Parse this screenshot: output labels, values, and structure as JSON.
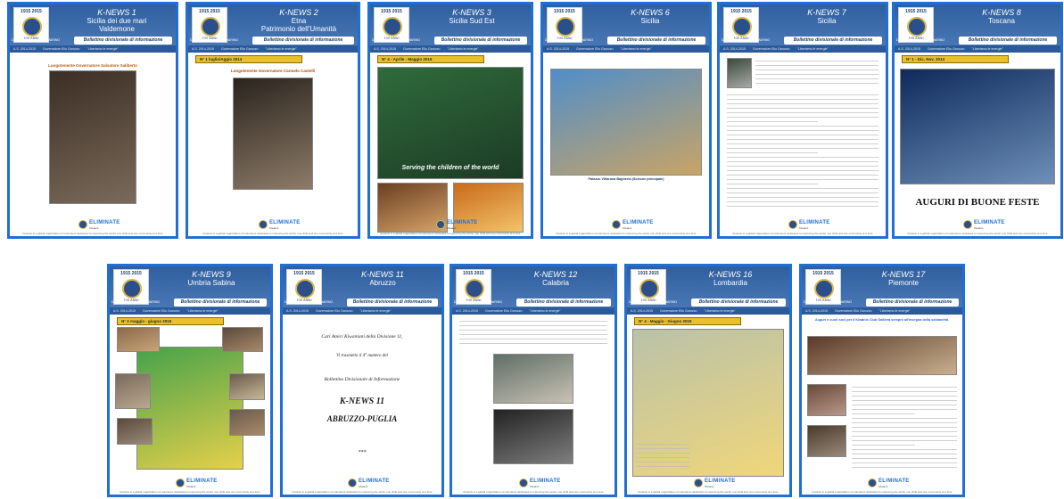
{
  "header": {
    "anniversary_years": "1915 2015",
    "anniversary_label": "100 ANNI",
    "district_line": "DISTRETTO ITALIA SAN MARINO",
    "subtitle": "Bollettino divisionale di informazione",
    "year_line": "A.S. 2014-2015",
    "governor_line": "Governatore Elio Garozzo",
    "motto": "\"Liberiamo le energie\""
  },
  "footer": {
    "brand": "ELIMINATE",
    "brand_sub": "Kiwanis",
    "tagline": "Kiwanis is a global organization of volunteers dedicated to improving the world, one child and one community at a time"
  },
  "issues": [
    {
      "title": "K-NEWS 1",
      "region_line1": "Sicilia dei due mari",
      "region_line2": "Valdemone",
      "gold_bar": "",
      "caption": "Luogotenente Governatore Salvatore Saliberto",
      "photo_colors": [
        "#3b2e24",
        "#7a6a5a"
      ]
    },
    {
      "title": "K-NEWS 2",
      "region_line1": "Etna",
      "region_line2": "Patrimonio dell'Umanità",
      "gold_bar": "N° 1 luglio/Aggio 2014",
      "caption": "Luogotenente Governatore Carmelo Castelli",
      "photo_colors": [
        "#2a241e",
        "#8d7b68"
      ]
    },
    {
      "title": "K-NEWS 3",
      "region_line1": "Sicilia Sud Est",
      "region_line2": "",
      "gold_bar": "N° 4 - Aprile - Maggio 2015",
      "caption": "Serving the children of the world",
      "photo_colors": [
        "#2f6b3a",
        "#1c3b26"
      ]
    },
    {
      "title": "K-NEWS 6",
      "region_line1": "Sicilia",
      "region_line2": "",
      "gold_bar": "",
      "caption": "Palazzo Villarosa Bagheria  (Sezione principale)",
      "photo_colors": [
        "#c9a466",
        "#4f8ec9"
      ]
    },
    {
      "title": "K-NEWS 7",
      "region_line1": "Sicilia",
      "region_line2": "",
      "gold_bar": "",
      "caption": "",
      "photo_colors": [
        "#3a4a3a",
        "#a8a8a8"
      ]
    },
    {
      "title": "K-NEWS 8",
      "region_line1": "Toscana",
      "region_line2": "",
      "gold_bar": "N° 1 - Dic. Nov. 2014",
      "caption": "AUGURI DI BUONE FESTE",
      "photo_colors": [
        "#0e2a5c",
        "#d9dfe6"
      ]
    },
    {
      "title": "K-NEWS 9",
      "region_line1": "Umbria Sabina",
      "region_line2": "",
      "gold_bar": "N° 2 maggio - giugno  2015",
      "caption": "",
      "photo_colors": [
        "#d64a5a",
        "#46a24a"
      ]
    },
    {
      "title": "K-NEWS 11",
      "region_line1": "Abruzzo",
      "region_line2": "",
      "gold_bar": "",
      "cover_lines": [
        "Cari Amici Kiwaniani della Divisione 11,",
        "Vi trasmetto il 4° numero del",
        "Bollettino Divisionale di Informazione",
        "K-NEWS 11",
        "ABRUZZO-PUGLIA",
        "***"
      ],
      "photo_colors": []
    },
    {
      "title": "K-NEWS 12",
      "region_line1": "Calabria",
      "region_line2": "",
      "gold_bar": "",
      "caption": "",
      "photo_colors": [
        "#5f6f66",
        "#222222"
      ]
    },
    {
      "title": "K-NEWS 16",
      "region_line1": "Lombardia",
      "region_line2": "",
      "gold_bar": "N° 4 - Maggio - Giugno 2015",
      "caption": "",
      "photo_colors": [
        "#b9c2a8",
        "#f0d67a"
      ]
    },
    {
      "title": "K-NEWS 17",
      "region_line1": "Piemonte",
      "region_line2": "",
      "gold_bar": "",
      "caption": "Auguri e cuori soci per il Kiwanis Club Galliera sempre all'insegna della solidarietà.",
      "photo_colors": [
        "#5a3a2a",
        "#c8b08e"
      ]
    }
  ]
}
